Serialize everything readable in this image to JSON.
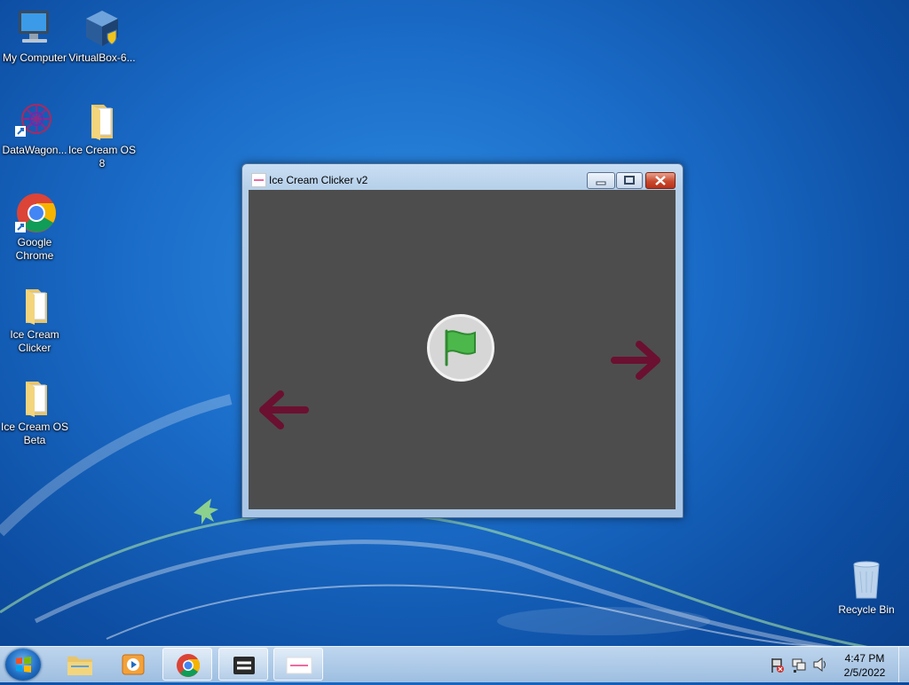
{
  "desktop": {
    "icons": [
      {
        "label": "My Computer",
        "icon": "computer-icon"
      },
      {
        "label": "VirtualBox-6...",
        "icon": "virtualbox-icon"
      },
      {
        "label": "DataWagon...",
        "icon": "datawagon-icon"
      },
      {
        "label": "Ice Cream OS 8",
        "icon": "folder-icon"
      },
      {
        "label": "Google Chrome",
        "icon": "chrome-icon"
      },
      {
        "label": "Ice Cream Clicker",
        "icon": "folder-icon"
      },
      {
        "label": "Ice Cream OS Beta",
        "icon": "folder-icon"
      }
    ],
    "recycle_bin": {
      "label": "Recycle Bin",
      "icon": "recycle-bin-icon"
    }
  },
  "window": {
    "title": "Ice Cream Clicker v2",
    "buttons": {
      "minimize": "minimize-icon",
      "maximize": "maximize-icon",
      "close": "close-icon"
    },
    "content": {
      "background": "#4d4d4d",
      "flag_color": "#4cb84c",
      "arrow_color": "#6b1030"
    }
  },
  "taskbar": {
    "items": [
      {
        "name": "start-button",
        "icon": "windows-logo-icon"
      },
      {
        "name": "explorer",
        "icon": "folder-icon"
      },
      {
        "name": "media-player",
        "icon": "media-player-icon"
      },
      {
        "name": "chrome",
        "icon": "chrome-icon"
      },
      {
        "name": "app-window",
        "icon": "app-icon"
      },
      {
        "name": "ice-cream-clicker",
        "icon": "pink-app-icon"
      }
    ],
    "clock": {
      "time": "4:47 PM",
      "date": "2/5/2022"
    }
  }
}
